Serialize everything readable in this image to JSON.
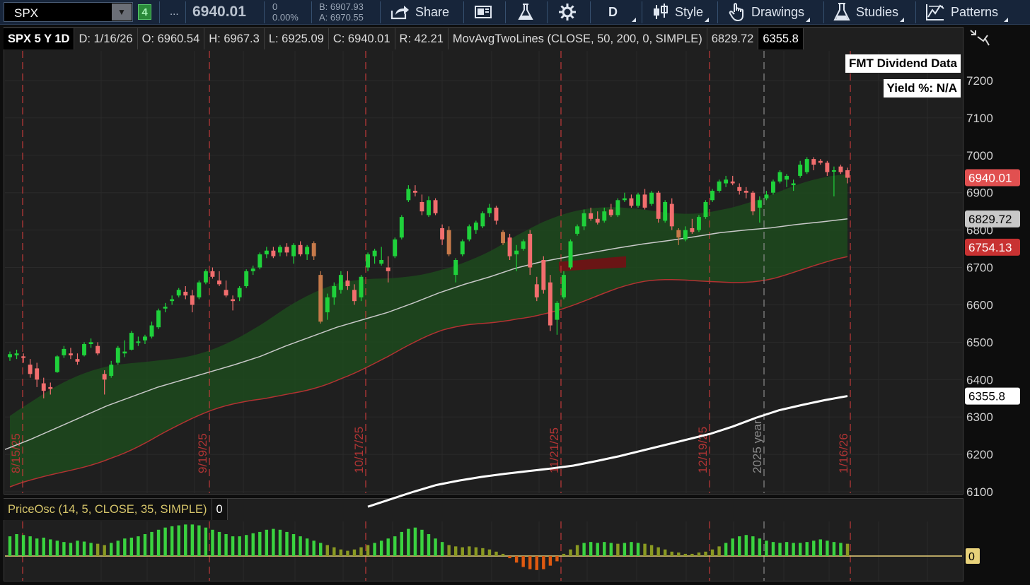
{
  "toolbar": {
    "symbol": "SPX",
    "link_group": "4",
    "more": "...",
    "last": "6940.01",
    "net_change": "0",
    "pct_change": "0.00%",
    "bid": "B: 6907.93",
    "ask": "A: 6970.55",
    "buttons": {
      "share": "Share",
      "aggregation": "D",
      "style": "Style",
      "drawings": "Drawings",
      "studies": "Studies",
      "patterns": "Patterns"
    },
    "icons": [
      "share-icon",
      "flexible-grid-icon",
      "beaker-icon",
      "gear-icon",
      "candle-style-icon",
      "drawings-hand-icon",
      "studies-flask-icon",
      "patterns-icon"
    ]
  },
  "header": {
    "title": "SPX 5 Y 1D",
    "date": "D: 1/16/26",
    "open": "O: 6960.54",
    "high": "H: 6967.3",
    "low": "L: 6925.09",
    "close": "C: 6940.01",
    "range": "R: 42.21",
    "study": "MovAvgTwoLines (CLOSE, 50, 200, 0, SIMPLE)",
    "ma50": "6829.72",
    "ma200": "6355.8"
  },
  "overlay": {
    "dividend_title": "FMT Dividend Data",
    "yield": "Yield %: N/A"
  },
  "lower_study": {
    "label": "PriceOsc (14, 5, CLOSE, 35, SIMPLE)",
    "value": "0",
    "zero_label": "0"
  },
  "chart_data": [
    {
      "type": "candlestick",
      "title": "SPX 5 Y 1D",
      "x_labels_visible": [
        "8/15/25",
        "9/19/25",
        "10/17/25",
        "11/21/25",
        "12/19/25",
        "2025 year",
        "1/16/26"
      ],
      "ylim": [
        6100,
        7250
      ],
      "y_ticks": [
        6100,
        6200,
        6300,
        6400,
        6500,
        6600,
        6700,
        6800,
        6900,
        7000,
        7100,
        7200
      ],
      "price_tags": [
        {
          "value": "6940.01",
          "color": "#e15050",
          "label": "last close"
        },
        {
          "value": "6829.72",
          "color": "#c8c8c8",
          "label": "50 SMA"
        },
        {
          "value": "6754.13",
          "color": "#c83232",
          "label": "cloud low"
        },
        {
          "value": "6355.8",
          "color": "#ffffff",
          "label": "200 SMA"
        }
      ],
      "candle_colors": {
        "up": "#1fd13b",
        "down": "#f26e6e",
        "special": "#c77a4a"
      },
      "vertical_markers": [
        {
          "date": "8/15/25",
          "color": "#c03a3a"
        },
        {
          "date": "9/19/25",
          "color": "#c03a3a"
        },
        {
          "date": "10/17/25",
          "color": "#c03a3a"
        },
        {
          "date": "11/21/25",
          "color": "#c03a3a"
        },
        {
          "date": "12/19/25",
          "color": "#c03a3a"
        },
        {
          "date": "2025 year",
          "color": "#8a8a8a"
        },
        {
          "date": "1/16/26",
          "color": "#c03a3a"
        }
      ],
      "series": [
        {
          "name": "ma50",
          "values": [
            6213,
            6240,
            6270,
            6300,
            6330,
            6355,
            6380,
            6400,
            6420,
            6440,
            6462,
            6490,
            6515,
            6540,
            6560,
            6580,
            6605,
            6632,
            6655,
            6675,
            6698,
            6715,
            6728,
            6740,
            6752,
            6763,
            6772,
            6782,
            6793,
            6800,
            6806,
            6815,
            6822,
            6830
          ]
        },
        {
          "name": "ma200",
          "values": [
            6060,
            6080,
            6100,
            6118,
            6130,
            6140,
            6148,
            6155,
            6162,
            6170,
            6182,
            6195,
            6210,
            6225,
            6240,
            6255,
            6275,
            6298,
            6318,
            6332,
            6345,
            6356
          ]
        }
      ],
      "candles": [
        {
          "o": 6460,
          "h": 6475,
          "l": 6450,
          "c": 6468
        },
        {
          "o": 6465,
          "h": 6480,
          "l": 6455,
          "c": 6470
        },
        {
          "o": 6462,
          "h": 6470,
          "l": 6445,
          "c": 6460
        },
        {
          "o": 6440,
          "h": 6455,
          "l": 6405,
          "c": 6415
        },
        {
          "o": 6430,
          "h": 6445,
          "l": 6380,
          "c": 6400
        },
        {
          "o": 6390,
          "h": 6405,
          "l": 6350,
          "c": 6370
        },
        {
          "o": 6380,
          "h": 6392,
          "l": 6360,
          "c": 6375
        },
        {
          "o": 6420,
          "h": 6465,
          "l": 6418,
          "c": 6462
        },
        {
          "o": 6465,
          "h": 6490,
          "l": 6458,
          "c": 6482
        },
        {
          "o": 6470,
          "h": 6485,
          "l": 6455,
          "c": 6465
        },
        {
          "o": 6455,
          "h": 6470,
          "l": 6440,
          "c": 6448
        },
        {
          "o": 6465,
          "h": 6500,
          "l": 6462,
          "c": 6495
        },
        {
          "o": 6495,
          "h": 6510,
          "l": 6485,
          "c": 6500
        },
        {
          "o": 6490,
          "h": 6500,
          "l": 6465,
          "c": 6470
        },
        {
          "o": 6415,
          "h": 6425,
          "l": 6360,
          "c": 6400
        },
        {
          "o": 6410,
          "h": 6450,
          "l": 6405,
          "c": 6440
        },
        {
          "o": 6445,
          "h": 6490,
          "l": 6440,
          "c": 6485
        },
        {
          "o": 6470,
          "h": 6505,
          "l": 6460,
          "c": 6475
        },
        {
          "o": 6480,
          "h": 6530,
          "l": 6478,
          "c": 6525
        },
        {
          "o": 6500,
          "h": 6515,
          "l": 6490,
          "c": 6502
        },
        {
          "o": 6505,
          "h": 6520,
          "l": 6495,
          "c": 6515
        },
        {
          "o": 6515,
          "h": 6555,
          "l": 6510,
          "c": 6545
        },
        {
          "o": 6540,
          "h": 6590,
          "l": 6535,
          "c": 6585
        },
        {
          "o": 6590,
          "h": 6605,
          "l": 6580,
          "c": 6595
        },
        {
          "o": 6610,
          "h": 6625,
          "l": 6600,
          "c": 6615
        },
        {
          "o": 6625,
          "h": 6645,
          "l": 6620,
          "c": 6640
        },
        {
          "o": 6635,
          "h": 6650,
          "l": 6615,
          "c": 6625
        },
        {
          "o": 6625,
          "h": 6640,
          "l": 6580,
          "c": 6600
        },
        {
          "o": 6620,
          "h": 6665,
          "l": 6615,
          "c": 6660
        },
        {
          "o": 6660,
          "h": 6695,
          "l": 6655,
          "c": 6690
        },
        {
          "o": 6690,
          "h": 6700,
          "l": 6670,
          "c": 6675
        },
        {
          "o": 6665,
          "h": 6690,
          "l": 6650,
          "c": 6655
        },
        {
          "o": 6640,
          "h": 6665,
          "l": 6620,
          "c": 6625
        },
        {
          "o": 6615,
          "h": 6625,
          "l": 6585,
          "c": 6610
        },
        {
          "o": 6620,
          "h": 6650,
          "l": 6610,
          "c": 6645
        },
        {
          "o": 6650,
          "h": 6695,
          "l": 6645,
          "c": 6690
        },
        {
          "o": 6690,
          "h": 6705,
          "l": 6680,
          "c": 6697
        },
        {
          "o": 6700,
          "h": 6740,
          "l": 6695,
          "c": 6735
        },
        {
          "o": 6735,
          "h": 6755,
          "l": 6725,
          "c": 6745
        },
        {
          "o": 6745,
          "h": 6755,
          "l": 6725,
          "c": 6730
        },
        {
          "o": 6740,
          "h": 6760,
          "l": 6730,
          "c": 6755
        },
        {
          "o": 6755,
          "h": 6765,
          "l": 6730,
          "c": 6740
        },
        {
          "o": 6730,
          "h": 6765,
          "l": 6710,
          "c": 6760
        },
        {
          "o": 6760,
          "h": 6770,
          "l": 6730,
          "c": 6735
        },
        {
          "o": 6735,
          "h": 6760,
          "l": 6720,
          "c": 6755
        },
        {
          "o": 6765,
          "h": 6770,
          "l": 6720,
          "c": 6730,
          "special": true
        },
        {
          "o": 6680,
          "h": 6690,
          "l": 6550,
          "c": 6555,
          "special": true
        },
        {
          "o": 6580,
          "h": 6630,
          "l": 6560,
          "c": 6620
        },
        {
          "o": 6620,
          "h": 6660,
          "l": 6600,
          "c": 6650
        },
        {
          "o": 6640,
          "h": 6690,
          "l": 6630,
          "c": 6680
        },
        {
          "o": 6665,
          "h": 6690,
          "l": 6640,
          "c": 6650
        },
        {
          "o": 6640,
          "h": 6655,
          "l": 6600,
          "c": 6610
        },
        {
          "o": 6620,
          "h": 6680,
          "l": 6610,
          "c": 6675
        },
        {
          "o": 6700,
          "h": 6740,
          "l": 6690,
          "c": 6735
        },
        {
          "o": 6730,
          "h": 6750,
          "l": 6710,
          "c": 6745
        },
        {
          "o": 6710,
          "h": 6755,
          "l": 6705,
          "c": 6720
        },
        {
          "o": 6700,
          "h": 6730,
          "l": 6660,
          "c": 6690
        },
        {
          "o": 6730,
          "h": 6780,
          "l": 6725,
          "c": 6775
        },
        {
          "o": 6780,
          "h": 6840,
          "l": 6775,
          "c": 6835
        },
        {
          "o": 6880,
          "h": 6920,
          "l": 6875,
          "c": 6910
        },
        {
          "o": 6905,
          "h": 6920,
          "l": 6890,
          "c": 6900
        },
        {
          "o": 6875,
          "h": 6895,
          "l": 6840,
          "c": 6850
        },
        {
          "o": 6840,
          "h": 6890,
          "l": 6835,
          "c": 6880
        },
        {
          "o": 6880,
          "h": 6885,
          "l": 6840,
          "c": 6845
        },
        {
          "o": 6805,
          "h": 6815,
          "l": 6760,
          "c": 6775
        },
        {
          "o": 6800,
          "h": 6810,
          "l": 6730,
          "c": 6735,
          "special": true
        },
        {
          "o": 6680,
          "h": 6725,
          "l": 6660,
          "c": 6720
        },
        {
          "o": 6735,
          "h": 6775,
          "l": 6730,
          "c": 6770
        },
        {
          "o": 6775,
          "h": 6815,
          "l": 6770,
          "c": 6810
        },
        {
          "o": 6800,
          "h": 6825,
          "l": 6790,
          "c": 6820
        },
        {
          "o": 6810,
          "h": 6850,
          "l": 6805,
          "c": 6845
        },
        {
          "o": 6845,
          "h": 6870,
          "l": 6835,
          "c": 6860
        },
        {
          "o": 6860,
          "h": 6865,
          "l": 6815,
          "c": 6825
        },
        {
          "o": 6795,
          "h": 6800,
          "l": 6760,
          "c": 6765,
          "special": true
        },
        {
          "o": 6780,
          "h": 6790,
          "l": 6720,
          "c": 6730
        },
        {
          "o": 6735,
          "h": 6760,
          "l": 6690,
          "c": 6745
        },
        {
          "o": 6750,
          "h": 6775,
          "l": 6745,
          "c": 6770
        },
        {
          "o": 6790,
          "h": 6800,
          "l": 6680,
          "c": 6700
        },
        {
          "o": 6655,
          "h": 6675,
          "l": 6610,
          "c": 6620
        },
        {
          "o": 6720,
          "h": 6730,
          "l": 6630,
          "c": 6640
        },
        {
          "o": 6660,
          "h": 6680,
          "l": 6530,
          "c": 6545
        },
        {
          "o": 6560,
          "h": 6610,
          "l": 6520,
          "c": 6605
        },
        {
          "o": 6620,
          "h": 6690,
          "l": 6615,
          "c": 6680
        },
        {
          "o": 6700,
          "h": 6775,
          "l": 6695,
          "c": 6770
        },
        {
          "o": 6790,
          "h": 6815,
          "l": 6785,
          "c": 6810
        },
        {
          "o": 6810,
          "h": 6855,
          "l": 6800,
          "c": 6845
        },
        {
          "o": 6845,
          "h": 6860,
          "l": 6825,
          "c": 6830
        },
        {
          "o": 6830,
          "h": 6850,
          "l": 6815,
          "c": 6820
        },
        {
          "o": 6825,
          "h": 6860,
          "l": 6820,
          "c": 6850
        },
        {
          "o": 6855,
          "h": 6870,
          "l": 6835,
          "c": 6840
        },
        {
          "o": 6840,
          "h": 6885,
          "l": 6835,
          "c": 6880
        },
        {
          "o": 6880,
          "h": 6900,
          "l": 6875,
          "c": 6885
        },
        {
          "o": 6885,
          "h": 6895,
          "l": 6860,
          "c": 6865
        },
        {
          "o": 6865,
          "h": 6900,
          "l": 6860,
          "c": 6895
        },
        {
          "o": 6895,
          "h": 6910,
          "l": 6855,
          "c": 6860
        },
        {
          "o": 6870,
          "h": 6905,
          "l": 6865,
          "c": 6900
        },
        {
          "o": 6900,
          "h": 6905,
          "l": 6820,
          "c": 6830
        },
        {
          "o": 6825,
          "h": 6880,
          "l": 6820,
          "c": 6875
        },
        {
          "o": 6870,
          "h": 6885,
          "l": 6800,
          "c": 6810
        },
        {
          "o": 6800,
          "h": 6805,
          "l": 6760,
          "c": 6780,
          "special": true
        },
        {
          "o": 6775,
          "h": 6810,
          "l": 6770,
          "c": 6800
        },
        {
          "o": 6805,
          "h": 6830,
          "l": 6790,
          "c": 6795
        },
        {
          "o": 6800,
          "h": 6840,
          "l": 6795,
          "c": 6835
        },
        {
          "o": 6835,
          "h": 6880,
          "l": 6830,
          "c": 6875
        },
        {
          "o": 6880,
          "h": 6910,
          "l": 6875,
          "c": 6905
        },
        {
          "o": 6905,
          "h": 6935,
          "l": 6900,
          "c": 6930
        },
        {
          "o": 6925,
          "h": 6945,
          "l": 6915,
          "c": 6935
        },
        {
          "o": 6930,
          "h": 6945,
          "l": 6920,
          "c": 6925
        },
        {
          "o": 6915,
          "h": 6925,
          "l": 6895,
          "c": 6905
        },
        {
          "o": 6905,
          "h": 6915,
          "l": 6885,
          "c": 6900
        },
        {
          "o": 6900,
          "h": 6905,
          "l": 6840,
          "c": 6850
        },
        {
          "o": 6860,
          "h": 6890,
          "l": 6820,
          "c": 6880
        },
        {
          "o": 6885,
          "h": 6905,
          "l": 6880,
          "c": 6895
        },
        {
          "o": 6900,
          "h": 6935,
          "l": 6895,
          "c": 6930
        },
        {
          "o": 6930,
          "h": 6960,
          "l": 6925,
          "c": 6955
        },
        {
          "o": 6935,
          "h": 6950,
          "l": 6915,
          "c": 6945
        },
        {
          "o": 6920,
          "h": 6935,
          "l": 6905,
          "c": 6925
        },
        {
          "o": 6945,
          "h": 6985,
          "l": 6940,
          "c": 6975
        },
        {
          "o": 6955,
          "h": 6995,
          "l": 6950,
          "c": 6990
        },
        {
          "o": 6990,
          "h": 6995,
          "l": 6960,
          "c": 6975
        },
        {
          "o": 6985,
          "h": 6990,
          "l": 6975,
          "c": 6980
        },
        {
          "o": 6980,
          "h": 6985,
          "l": 6945,
          "c": 6955
        },
        {
          "o": 6960,
          "h": 6970,
          "l": 6890,
          "c": 6960
        },
        {
          "o": 6970,
          "h": 6975,
          "l": 6950,
          "c": 6955
        },
        {
          "o": 6960,
          "h": 6967,
          "l": 6925,
          "c": 6940
        }
      ]
    },
    {
      "type": "bar",
      "title": "PriceOsc (14, 5, CLOSE, 35, SIMPLE)",
      "zero_line": 0,
      "colors": {
        "high": "#3ad33f",
        "mid": "#8a9a22",
        "neg": "#e05a10"
      },
      "values": [
        0.45,
        0.5,
        0.48,
        0.45,
        0.4,
        0.42,
        0.38,
        0.35,
        0.32,
        0.3,
        0.35,
        0.33,
        0.3,
        0.28,
        0.25,
        0.3,
        0.35,
        0.4,
        0.42,
        0.45,
        0.5,
        0.55,
        0.6,
        0.65,
        0.68,
        0.7,
        0.72,
        0.72,
        0.7,
        0.65,
        0.6,
        0.55,
        0.5,
        0.45,
        0.45,
        0.48,
        0.52,
        0.55,
        0.6,
        0.62,
        0.6,
        0.55,
        0.5,
        0.45,
        0.4,
        0.35,
        0.3,
        0.25,
        0.2,
        0.15,
        0.12,
        0.15,
        0.2,
        0.25,
        0.3,
        0.35,
        0.4,
        0.45,
        0.55,
        0.62,
        0.65,
        0.6,
        0.5,
        0.4,
        0.32,
        0.25,
        0.22,
        0.2,
        0.22,
        0.2,
        0.18,
        0.15,
        0.1,
        0.05,
        -0.05,
        -0.15,
        -0.25,
        -0.3,
        -0.32,
        -0.3,
        -0.22,
        -0.12,
        0.05,
        0.15,
        0.25,
        0.3,
        0.32,
        0.3,
        0.32,
        0.3,
        0.28,
        0.3,
        0.32,
        0.3,
        0.28,
        0.25,
        0.2,
        0.15,
        0.1,
        0.08,
        0.05,
        0.05,
        0.08,
        0.1,
        0.15,
        0.22,
        0.3,
        0.4,
        0.45,
        0.48,
        0.45,
        0.4,
        0.35,
        0.32,
        0.3,
        0.32,
        0.3,
        0.3,
        0.32,
        0.35,
        0.38,
        0.35,
        0.32,
        0.3,
        0.28
      ]
    }
  ]
}
